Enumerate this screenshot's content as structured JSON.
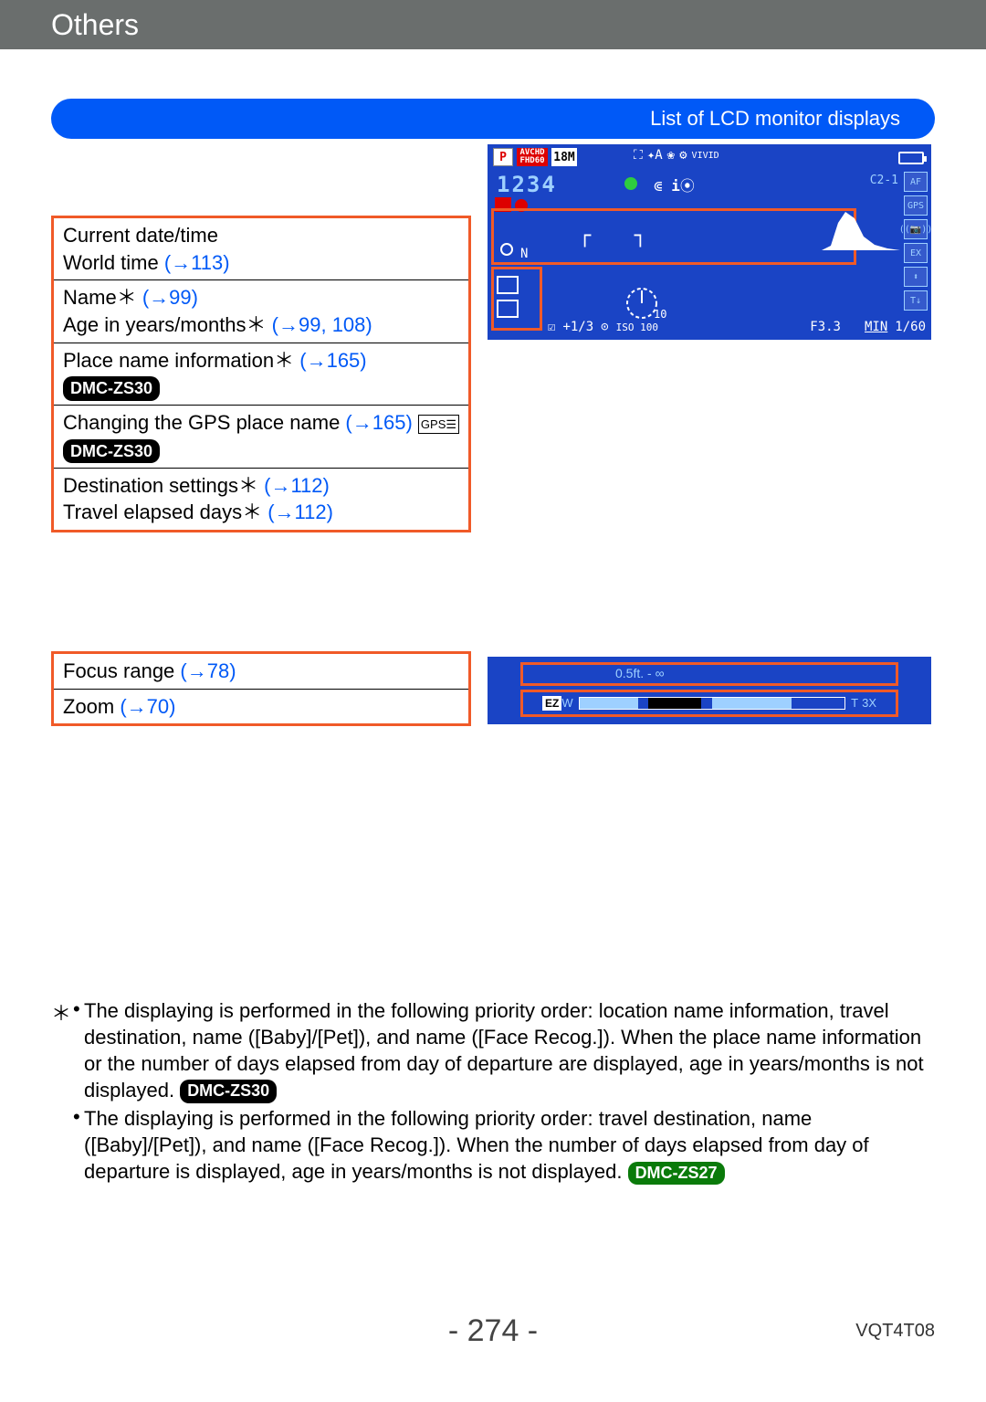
{
  "header": {
    "title": "Others"
  },
  "pill": {
    "label": "List of LCD monitor displays"
  },
  "table1": {
    "rows": [
      {
        "parts": [
          {
            "t": "Current date/time",
            "type": "text"
          }
        ],
        "parts2": [
          {
            "t": "World time ",
            "type": "text"
          },
          {
            "t": "(→113)",
            "type": "link"
          }
        ]
      },
      {
        "parts": [
          {
            "t": "Name",
            "type": "text"
          },
          {
            "t": "＊",
            "type": "ast"
          },
          {
            "t": " (→99)",
            "type": "link"
          }
        ],
        "parts2": [
          {
            "t": "Age in years/months",
            "type": "text"
          },
          {
            "t": "＊",
            "type": "ast"
          },
          {
            "t": " (→99, 108)",
            "type": "link"
          }
        ]
      },
      {
        "parts": [
          {
            "t": "Place name information",
            "type": "text"
          },
          {
            "t": "＊",
            "type": "ast"
          },
          {
            "t": " (→165)",
            "type": "link"
          },
          {
            "t": " ",
            "type": "text"
          },
          {
            "t": "DMC-ZS30",
            "type": "badge"
          }
        ]
      },
      {
        "parts": [
          {
            "t": "Changing the GPS place name ",
            "type": "text"
          },
          {
            "t": "(→165)",
            "type": "link"
          },
          {
            "t": " ",
            "type": "text"
          },
          {
            "t": "GPS",
            "type": "gps"
          }
        ],
        "parts2": [
          {
            "t": "DMC-ZS30",
            "type": "badge"
          }
        ]
      },
      {
        "parts": [
          {
            "t": "Destination settings",
            "type": "text"
          },
          {
            "t": "＊",
            "type": "ast"
          },
          {
            "t": " (→112)",
            "type": "link"
          }
        ],
        "parts2": [
          {
            "t": "Travel elapsed days",
            "type": "text"
          },
          {
            "t": "＊",
            "type": "ast"
          },
          {
            "t": " (→112)",
            "type": "link"
          }
        ]
      }
    ]
  },
  "table2": {
    "rows": [
      {
        "parts": [
          {
            "t": "Focus range ",
            "type": "text"
          },
          {
            "t": "(→78)",
            "type": "link"
          }
        ]
      },
      {
        "parts": [
          {
            "t": "Zoom ",
            "type": "text"
          },
          {
            "t": "(→70)",
            "type": "link"
          }
        ]
      }
    ]
  },
  "lcd": {
    "p": "P",
    "rec": "AVCHD FHD60",
    "mp": "18M",
    "count": "1234",
    "timer_sub": "10",
    "f": "F3.3",
    "ss": "1/60",
    "ev": "+1/3",
    "iso": "ISO 100",
    "c2": "C2-1",
    "n": "N",
    "vivid": "VIVID"
  },
  "lcd2": {
    "range": "0.5ft. - ∞",
    "ez": "EZ",
    "w": "W",
    "t": "T",
    "zoom": "3X"
  },
  "footnotes": {
    "star": "＊",
    "note1_text": "The displaying is performed in the following priority order: location name information, travel destination, name ([Baby]/[Pet]), and name ([Face Recog.]). When the place name information or the number of days elapsed from day of departure are displayed, age in years/months is not displayed. ",
    "note1_badge": "DMC-ZS30",
    "note2_text": "The displaying is performed in the following priority order: travel destination, name ([Baby]/[Pet]), and name ([Face Recog.]). When the number of days elapsed from day of departure is displayed, age in years/months is not displayed. ",
    "note2_badge": "DMC-ZS27"
  },
  "footer": {
    "page": "- 274 -",
    "code": "VQT4T08"
  }
}
